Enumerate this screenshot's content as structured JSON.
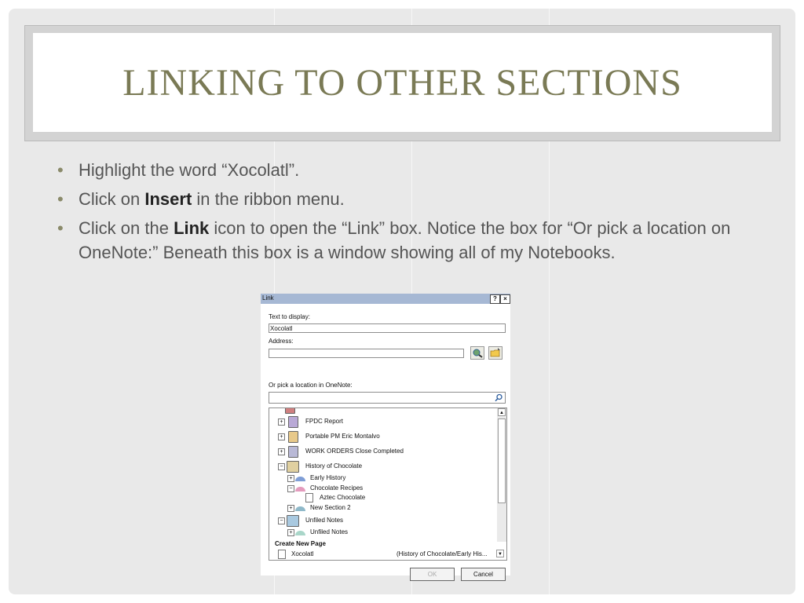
{
  "slide": {
    "title": "LINKING TO OTHER SECTIONS",
    "bullets": [
      {
        "pre": "Highlight the word “Xocolatl”.",
        "bold": "",
        "post": ""
      },
      {
        "pre": "Click on ",
        "bold": "Insert",
        "post": " in the ribbon menu."
      },
      {
        "pre": "Click on the ",
        "bold": "Link",
        "post": " icon to open the “Link” box.  Notice the box for “Or pick a location on OneNote:”  Beneath this box is a window showing all of my Notebooks."
      }
    ],
    "bullet_glyph": "•"
  },
  "dialog": {
    "title": "Link",
    "help_btn": "?",
    "close_btn": "×",
    "text_to_display_label": "Text to display:",
    "text_to_display_value": "Xocolatl",
    "address_label": "Address:",
    "address_value": "",
    "pick_label": "Or pick a location in OneNote:",
    "search_value": "",
    "tree": [
      {
        "label": "FPDC Report",
        "expander": "+",
        "icon": "notebook-icon",
        "color": "#b9a9d6"
      },
      {
        "label": "Portable PM Eric Montalvo",
        "expander": "+",
        "icon": "notebook-icon",
        "color": "#e8c98a"
      },
      {
        "label": "WORK ORDERS Close Completed",
        "expander": "+",
        "icon": "notebook-icon",
        "color": "#b9b9d6"
      },
      {
        "label": "History of Chocolate",
        "expander": "−",
        "icon": "open-notebook-icon",
        "color": "#e0d0a0"
      },
      {
        "label": "Early History",
        "expander": "+",
        "icon": "section-icon",
        "color": "#7f9ed6"
      },
      {
        "label": "Chocolate Recipes",
        "expander": "−",
        "icon": "section-icon",
        "color": "#e49bbd"
      },
      {
        "label": "Aztec Chocolate",
        "expander": "",
        "icon": "page-icon",
        "color": "#ffffff"
      },
      {
        "label": "New Section 2",
        "expander": "+",
        "icon": "section-icon",
        "color": "#8fb9c9"
      },
      {
        "label": "Unfiled Notes",
        "expander": "−",
        "icon": "unfiled-notes-icon",
        "color": "#a9c9e0"
      },
      {
        "label": "Unfiled Notes",
        "expander": "+",
        "icon": "section-icon",
        "color": "#a9d6c9"
      }
    ],
    "create_new_page_label": "Create New Page",
    "new_page": {
      "name": "Xocolatl",
      "location": "(History of Chocolate/Early His..."
    },
    "ok_label": "OK",
    "cancel_label": "Cancel",
    "colors": {
      "titlebar": "#a6b8d4"
    }
  }
}
